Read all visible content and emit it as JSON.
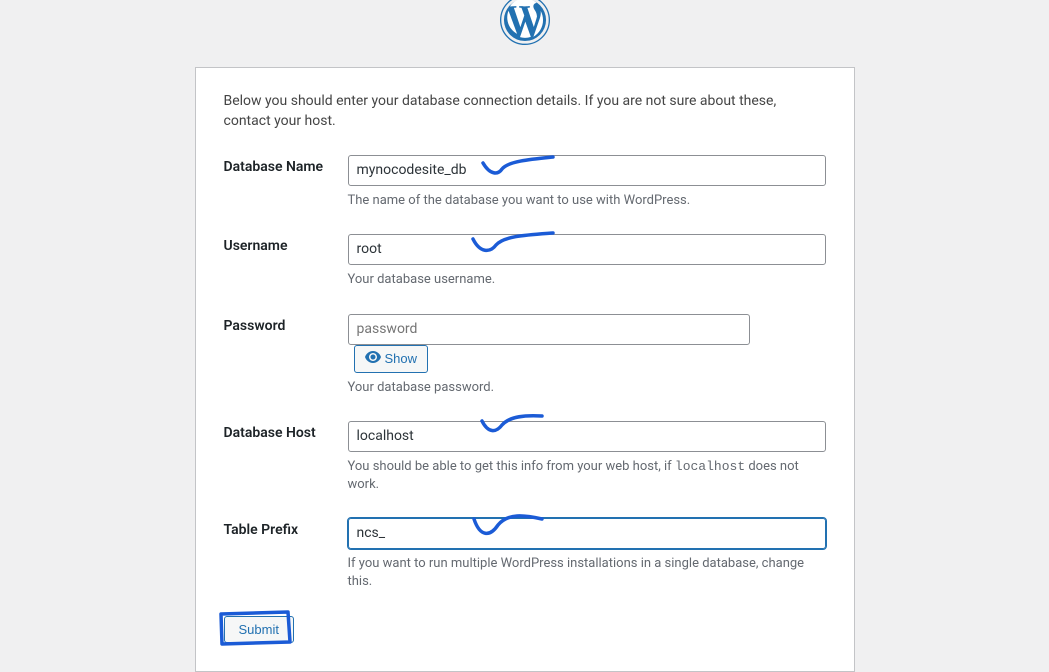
{
  "intro": "Below you should enter your database connection details. If you are not sure about these, contact your host.",
  "fields": {
    "dbname": {
      "label": "Database Name",
      "value": "mynocodesite_db",
      "help": "The name of the database you want to use with WordPress."
    },
    "username": {
      "label": "Username",
      "value": "root",
      "help": "Your database username."
    },
    "password": {
      "label": "Password",
      "placeholder": "password",
      "value": "",
      "help": "Your database password.",
      "show_label": "Show"
    },
    "dbhost": {
      "label": "Database Host",
      "value": "localhost",
      "help_prefix": "You should be able to get this info from your web host, if ",
      "help_code": "localhost",
      "help_suffix": " does not work."
    },
    "prefix": {
      "label": "Table Prefix",
      "value": "ncs_",
      "help": "If you want to run multiple WordPress installations in a single database, change this."
    }
  },
  "submit_label": "Submit",
  "colors": {
    "wp_blue": "#2271b1",
    "annotation_blue": "#1b5bd6"
  }
}
